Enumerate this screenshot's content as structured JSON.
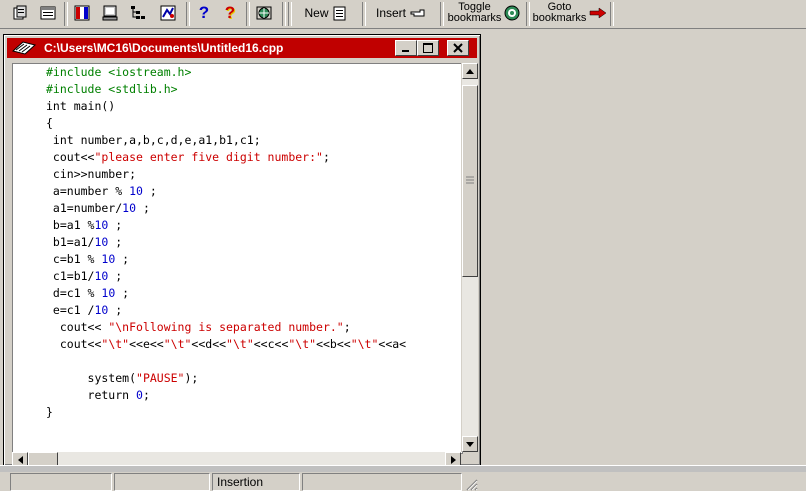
{
  "toolbar": {
    "icons": [
      "project-icon",
      "open-icon",
      "compile-icon",
      "run-icon",
      "debug-icon",
      "class-browser-icon",
      "help-icon",
      "about-icon",
      "web-icon"
    ],
    "new_label": "New",
    "insert_label": "Insert",
    "toggle_label_1": "Toggle",
    "toggle_label_2": "bookmarks",
    "goto_label_1": "Goto",
    "goto_label_2": "bookmarks"
  },
  "window": {
    "title": "C:\\Users\\MC16\\Documents\\Untitled16.cpp",
    "title_bar_color": "#c00000"
  },
  "editor": {
    "lines": [
      {
        "segs": [
          {
            "t": "#include <iostream.h>",
            "c": "pp"
          }
        ]
      },
      {
        "segs": [
          {
            "t": "#include <stdlib.h>",
            "c": "pp"
          }
        ]
      },
      {
        "segs": [
          {
            "t": "int main()",
            "c": "kw"
          }
        ]
      },
      {
        "segs": [
          {
            "t": "{",
            "c": "kw"
          }
        ]
      },
      {
        "segs": [
          {
            "t": " int number,a,b,c,d,e,a1,b1,c1;",
            "c": "kw"
          }
        ]
      },
      {
        "segs": [
          {
            "t": " cout<<",
            "c": "kw"
          },
          {
            "t": "\"please enter five digit number:\"",
            "c": "str"
          },
          {
            "t": ";",
            "c": "kw"
          }
        ]
      },
      {
        "segs": [
          {
            "t": " cin>>number;",
            "c": "kw"
          }
        ]
      },
      {
        "segs": [
          {
            "t": " a=number % ",
            "c": "kw"
          },
          {
            "t": "10",
            "c": "num"
          },
          {
            "t": " ;",
            "c": "kw"
          }
        ]
      },
      {
        "segs": [
          {
            "t": " a1=number/",
            "c": "kw"
          },
          {
            "t": "10",
            "c": "num"
          },
          {
            "t": " ;",
            "c": "kw"
          }
        ]
      },
      {
        "segs": [
          {
            "t": " b=a1 %",
            "c": "kw"
          },
          {
            "t": "10",
            "c": "num"
          },
          {
            "t": " ;",
            "c": "kw"
          }
        ]
      },
      {
        "segs": [
          {
            "t": " b1=a1/",
            "c": "kw"
          },
          {
            "t": "10",
            "c": "num"
          },
          {
            "t": " ;",
            "c": "kw"
          }
        ]
      },
      {
        "segs": [
          {
            "t": " c=b1 % ",
            "c": "kw"
          },
          {
            "t": "10",
            "c": "num"
          },
          {
            "t": " ;",
            "c": "kw"
          }
        ]
      },
      {
        "segs": [
          {
            "t": " c1=b1/",
            "c": "kw"
          },
          {
            "t": "10",
            "c": "num"
          },
          {
            "t": " ;",
            "c": "kw"
          }
        ]
      },
      {
        "segs": [
          {
            "t": " d=c1 % ",
            "c": "kw"
          },
          {
            "t": "10",
            "c": "num"
          },
          {
            "t": " ;",
            "c": "kw"
          }
        ]
      },
      {
        "segs": [
          {
            "t": " e=c1 /",
            "c": "kw"
          },
          {
            "t": "10",
            "c": "num"
          },
          {
            "t": " ;",
            "c": "kw"
          }
        ]
      },
      {
        "segs": [
          {
            "t": "  cout<< ",
            "c": "kw"
          },
          {
            "t": "\"\\nFollowing is separated number.\"",
            "c": "str"
          },
          {
            "t": ";",
            "c": "kw"
          }
        ]
      },
      {
        "segs": [
          {
            "t": "  cout<<",
            "c": "kw"
          },
          {
            "t": "\"\\t\"",
            "c": "str"
          },
          {
            "t": "<<e<<",
            "c": "kw"
          },
          {
            "t": "\"\\t\"",
            "c": "str"
          },
          {
            "t": "<<d<<",
            "c": "kw"
          },
          {
            "t": "\"\\t\"",
            "c": "str"
          },
          {
            "t": "<<c<<",
            "c": "kw"
          },
          {
            "t": "\"\\t\"",
            "c": "str"
          },
          {
            "t": "<<b<<",
            "c": "kw"
          },
          {
            "t": "\"\\t\"",
            "c": "str"
          },
          {
            "t": "<<a<",
            "c": "kw"
          }
        ]
      },
      {
        "segs": [
          {
            "t": "",
            "c": "kw"
          }
        ]
      },
      {
        "segs": [
          {
            "t": "      system(",
            "c": "kw"
          },
          {
            "t": "\"PAUSE\"",
            "c": "str"
          },
          {
            "t": ");",
            "c": "kw"
          }
        ]
      },
      {
        "segs": [
          {
            "t": "      return ",
            "c": "kw"
          },
          {
            "t": "0",
            "c": "num"
          },
          {
            "t": ";",
            "c": "kw"
          }
        ]
      },
      {
        "segs": [
          {
            "t": "}",
            "c": "kw"
          }
        ]
      }
    ]
  },
  "status": {
    "mode": "Insertion"
  }
}
